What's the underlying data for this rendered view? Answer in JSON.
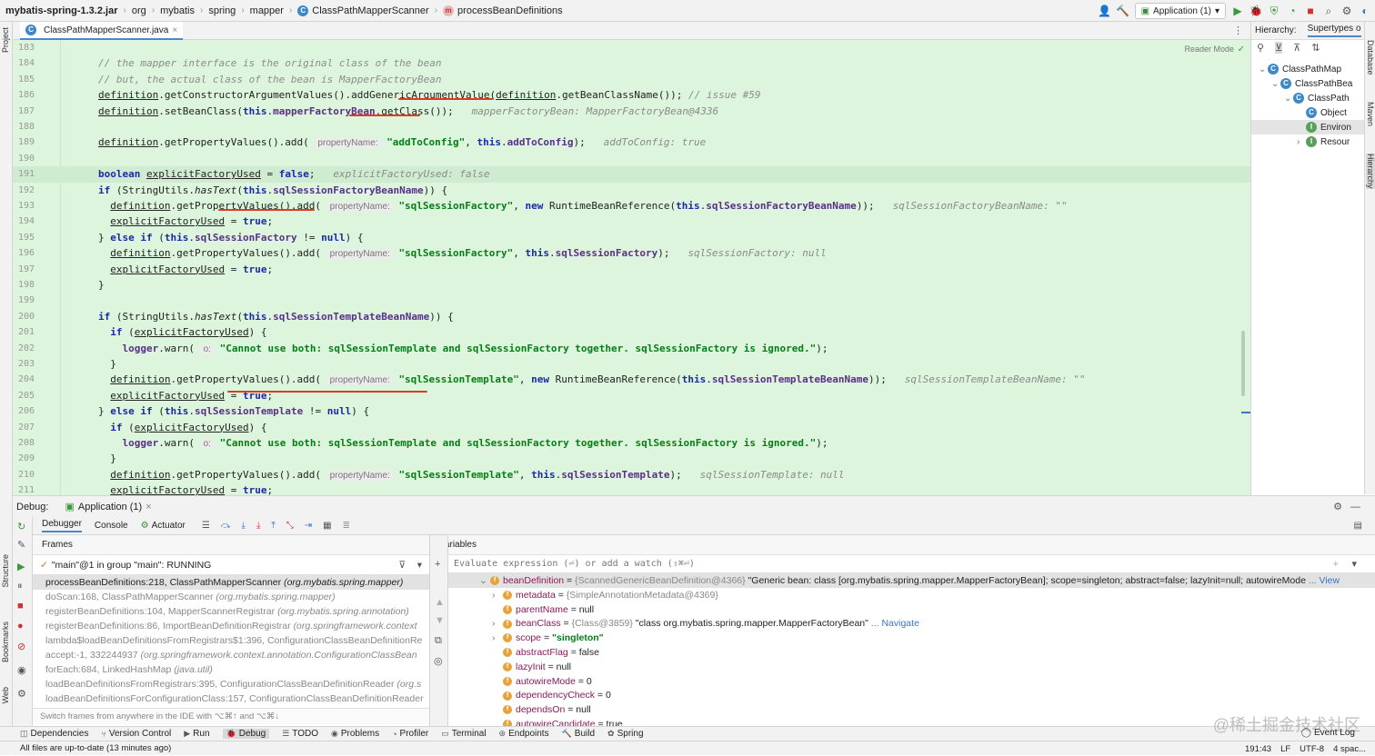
{
  "breadcrumb": [
    "mybatis-spring-1.3.2.jar",
    "org",
    "mybatis",
    "spring",
    "mapper",
    "ClassPathMapperScanner",
    "processBeanDefinitions"
  ],
  "run_config": "Application (1)",
  "file_tab": "ClassPathMapperScanner.java",
  "reader_mode": "Reader Mode",
  "left_tool_labels": [
    "Project",
    "Structure",
    "Bookmarks",
    "Web"
  ],
  "right_tool_labels": [
    "Database",
    "Maven",
    "Hierarchy"
  ],
  "hierarchy": {
    "title": "Hierarchy:",
    "tab": "Supertypes o",
    "items": [
      "ClassPathMap",
      "ClassPathBea",
      "ClassPath",
      "Object",
      "Environ",
      "Resour"
    ]
  },
  "code_lines": [
    {
      "n": "183",
      "html": ""
    },
    {
      "n": "184",
      "html": "<span class='cmt'>// the mapper interface is the original class of the bean</span>"
    },
    {
      "n": "185",
      "html": "<span class='cmt'>// but, the actual class of the bean is MapperFactoryBean</span>"
    },
    {
      "n": "186",
      "html": "<span class='ul'>definition</span>.getConstructorArgumentValues().addGenericArgumentValue(<span class='ul'>definition</span>.getBeanClassName()); <span class='cmt'>// issue #59</span>"
    },
    {
      "n": "187",
      "html": "<span class='ul'>definition</span>.setBeanClass(<span class='kw'>this</span>.<span class='fld'>mapperFactoryBean</span>.getClass());   <span class='iv'>mapperFactoryBean: MapperFactoryBean@4336</span>"
    },
    {
      "n": "188",
      "html": ""
    },
    {
      "n": "189",
      "html": "<span class='ul'>definition</span>.getPropertyValues().add( <span class='hint'>propertyName:</span> <span class='str'>\"addToConfig\"</span>, <span class='kw'>this</span>.<span class='fld'>addToConfig</span>);   <span class='iv'>addToConfig: true</span>"
    },
    {
      "n": "190",
      "html": ""
    },
    {
      "n": "191",
      "html": "<span class='kw'>boolean</span> <span class='ul'>explicitFactoryUsed</span> = <span class='kw'>false</span>;   <span class='iv'>explicitFactoryUsed: false</span>"
    },
    {
      "n": "192",
      "html": "<span class='kw'>if</span> (StringUtils.<span class='it'>hasText</span>(<span class='kw'>this</span>.<span class='fld'>sqlSessionFactoryBeanName</span>)) {"
    },
    {
      "n": "193",
      "html": "  <span class='ul'>definition</span>.getPropertyValues().add( <span class='hint'>propertyName:</span> <span class='str'>\"sqlSessionFactory\"</span>, <span class='kw'>new</span> RuntimeBeanReference(<span class='kw'>this</span>.<span class='fld'>sqlSessionFactoryBeanName</span>));   <span class='iv'>sqlSessionFactoryBeanName: \"\"</span>"
    },
    {
      "n": "194",
      "html": "  <span class='ul'>explicitFactoryUsed</span> = <span class='kw'>true</span>;"
    },
    {
      "n": "195",
      "html": "} <span class='kw'>else if</span> (<span class='kw'>this</span>.<span class='fld'>sqlSessionFactory</span> != <span class='kw'>null</span>) {"
    },
    {
      "n": "196",
      "html": "  <span class='ul'>definition</span>.getPropertyValues().add( <span class='hint'>propertyName:</span> <span class='str'>\"sqlSessionFactory\"</span>, <span class='kw'>this</span>.<span class='fld'>sqlSessionFactory</span>);   <span class='iv'>sqlSessionFactory: null</span>"
    },
    {
      "n": "197",
      "html": "  <span class='ul'>explicitFactoryUsed</span> = <span class='kw'>true</span>;"
    },
    {
      "n": "198",
      "html": "}"
    },
    {
      "n": "199",
      "html": ""
    },
    {
      "n": "200",
      "html": "<span class='kw'>if</span> (StringUtils.<span class='it'>hasText</span>(<span class='kw'>this</span>.<span class='fld'>sqlSessionTemplateBeanName</span>)) {"
    },
    {
      "n": "201",
      "html": "  <span class='kw'>if</span> (<span class='ul'>explicitFactoryUsed</span>) {"
    },
    {
      "n": "202",
      "html": "    <span class='fld'>logger</span>.warn( <span class='hint'>o:</span> <span class='str'>\"Cannot use both: sqlSessionTemplate and sqlSessionFactory together. sqlSessionFactory is ignored.\"</span>);"
    },
    {
      "n": "203",
      "html": "  }"
    },
    {
      "n": "204",
      "html": "  <span class='ul'>definition</span>.getPropertyValues().add( <span class='hint'>propertyName:</span> <span class='str'>\"sqlSessionTemplate\"</span>, <span class='kw'>new</span> RuntimeBeanReference(<span class='kw'>this</span>.<span class='fld'>sqlSessionTemplateBeanName</span>));   <span class='iv'>sqlSessionTemplateBeanName: \"\"</span>"
    },
    {
      "n": "205",
      "html": "  <span class='ul'>explicitFactoryUsed</span> = <span class='kw'>true</span>;"
    },
    {
      "n": "206",
      "html": "} <span class='kw'>else if</span> (<span class='kw'>this</span>.<span class='fld'>sqlSessionTemplate</span> != <span class='kw'>null</span>) {"
    },
    {
      "n": "207",
      "html": "  <span class='kw'>if</span> (<span class='ul'>explicitFactoryUsed</span>) {"
    },
    {
      "n": "208",
      "html": "    <span class='fld'>logger</span>.warn( <span class='hint'>o:</span> <span class='str'>\"Cannot use both: sqlSessionTemplate and sqlSessionFactory together. sqlSessionFactory is ignored.\"</span>);"
    },
    {
      "n": "209",
      "html": "  }"
    },
    {
      "n": "210",
      "html": "  <span class='ul'>definition</span>.getPropertyValues().add( <span class='hint'>propertyName:</span> <span class='str'>\"sqlSessionTemplate\"</span>, <span class='kw'>this</span>.<span class='fld'>sqlSessionTemplate</span>);   <span class='iv'>sqlSessionTemplate: null</span>"
    },
    {
      "n": "211",
      "html": "  <span class='ul'>explicitFactoryUsed</span> = <span class='kw'>true</span>;"
    }
  ],
  "debug": {
    "label": "Debug:",
    "session_tab": "Application (1)",
    "tabs": [
      "Debugger",
      "Console",
      "Actuator"
    ],
    "frames_title": "Frames",
    "thread": "\"main\"@1 in group \"main\": RUNNING",
    "frames": [
      {
        "m": "processBeanDefinitions:218, ClassPathMapperScanner",
        "p": "(org.mybatis.spring.mapper)"
      },
      {
        "m": "doScan:168, ClassPathMapperScanner",
        "p": "(org.mybatis.spring.mapper)"
      },
      {
        "m": "registerBeanDefinitions:104, MapperScannerRegistrar",
        "p": "(org.mybatis.spring.annotation)"
      },
      {
        "m": "registerBeanDefinitions:86, ImportBeanDefinitionRegistrar",
        "p": "(org.springframework.context"
      },
      {
        "m": "lambda$loadBeanDefinitionsFromRegistrars$1:396, ConfigurationClassBeanDefinitionRe",
        "p": ""
      },
      {
        "m": "accept:-1, 332244937",
        "p": "(org.springframework.context.annotation.ConfigurationClassBean"
      },
      {
        "m": "forEach:684, LinkedHashMap",
        "p": "(java.util)"
      },
      {
        "m": "loadBeanDefinitionsFromRegistrars:395, ConfigurationClassBeanDefinitionReader",
        "p": "(org.s"
      },
      {
        "m": "loadBeanDefinitionsForConfigurationClass:157, ConfigurationClassBeanDefinitionReader",
        "p": ""
      }
    ],
    "frames_hint": "Switch frames from anywhere in the IDE with ⌥⌘↑ and ⌥⌘↓",
    "variables_title": "Variables",
    "eval_placeholder": "Evaluate expression (⏎) or add a watch (⇧⌘⏎)",
    "variables": [
      {
        "indent": 0,
        "exp": "⌄",
        "name": "beanDefinition",
        "eq": " = ",
        "gray": "{ScannedGenericBeanDefinition@4366}",
        "val": " \"Generic bean: class [org.mybatis.spring.mapper.MapperFactoryBean]; scope=singleton; abstract=false; lazyInit=null; autowireMode",
        "link": " ... View"
      },
      {
        "indent": 1,
        "exp": "›",
        "name": "metadata",
        "eq": " = ",
        "gray": "{SimpleAnnotationMetadata@4369}",
        "val": "",
        "link": ""
      },
      {
        "indent": 1,
        "exp": "",
        "name": "parentName",
        "eq": " = ",
        "gray": "",
        "val": "null",
        "link": ""
      },
      {
        "indent": 1,
        "exp": "›",
        "name": "beanClass",
        "eq": " = ",
        "gray": "{Class@3859}",
        "val": " \"class org.mybatis.spring.mapper.MapperFactoryBean\"",
        "link": " ... Navigate"
      },
      {
        "indent": 1,
        "exp": "›",
        "name": "scope",
        "eq": " = ",
        "gray": "",
        "val": "\"singleton\"",
        "link": ""
      },
      {
        "indent": 1,
        "exp": "",
        "name": "abstractFlag",
        "eq": " = ",
        "gray": "",
        "val": "false",
        "link": ""
      },
      {
        "indent": 1,
        "exp": "",
        "name": "lazyInit",
        "eq": " = ",
        "gray": "",
        "val": "null",
        "link": ""
      },
      {
        "indent": 1,
        "exp": "",
        "name": "autowireMode",
        "eq": " = ",
        "gray": "",
        "val": "0",
        "link": ""
      },
      {
        "indent": 1,
        "exp": "",
        "name": "dependencyCheck",
        "eq": " = ",
        "gray": "",
        "val": "0",
        "link": ""
      },
      {
        "indent": 1,
        "exp": "",
        "name": "dependsOn",
        "eq": " = ",
        "gray": "",
        "val": "null",
        "link": ""
      },
      {
        "indent": 1,
        "exp": "",
        "name": "autowireCandidate",
        "eq": " = ",
        "gray": "",
        "val": "true",
        "link": ""
      }
    ]
  },
  "bottom_tools": [
    "Dependencies",
    "Version Control",
    "Run",
    "Debug",
    "TODO",
    "Problems",
    "Profiler",
    "Terminal",
    "Endpoints",
    "Build",
    "Spring"
  ],
  "event_log": "Event Log",
  "status": {
    "message": "All files are up-to-date (13 minutes ago)",
    "position": "191:43",
    "line_sep": "LF",
    "encoding": "UTF-8",
    "indent": "4 spac..."
  },
  "watermark": "@稀土掘金技术社区",
  "colors": {
    "editor_bg": "#dcf5dc",
    "annotation_red": "#e03a1f",
    "keyword": "#1c28a8",
    "string": "#067d17"
  }
}
